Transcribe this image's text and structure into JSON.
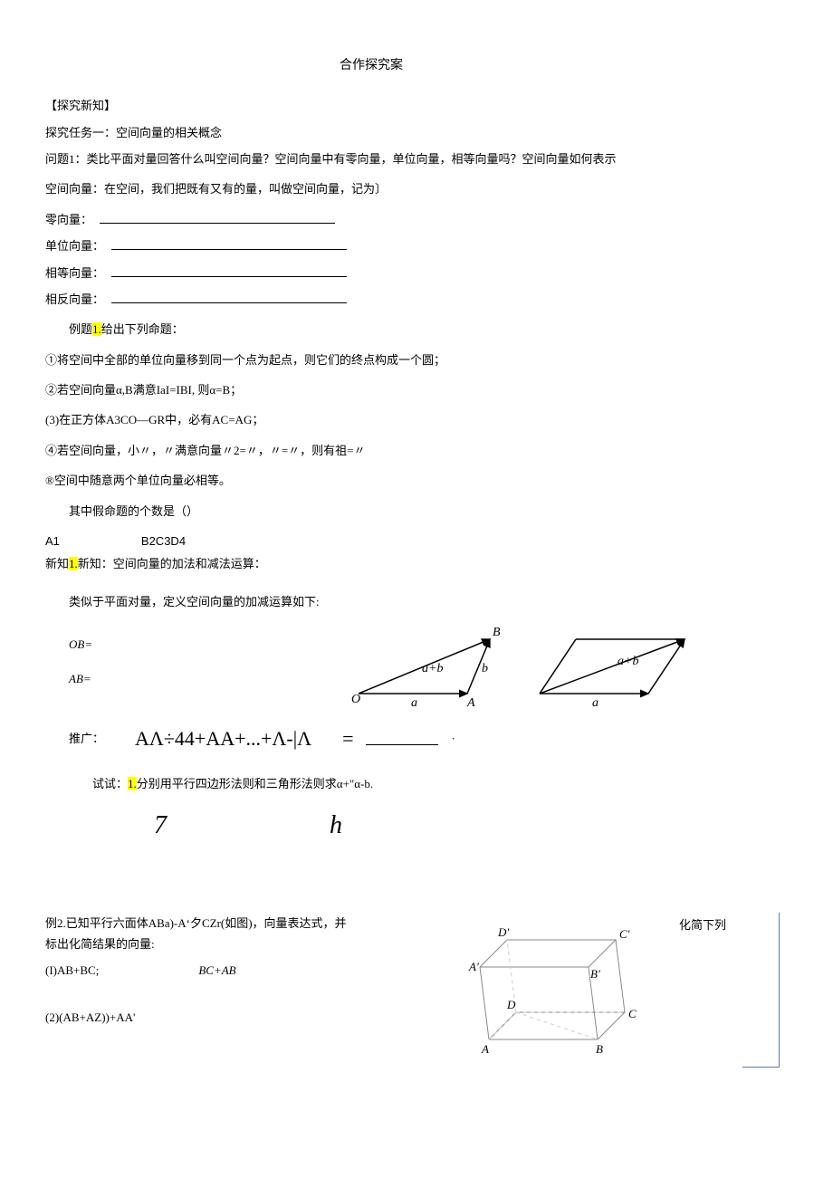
{
  "title": "合作探究案",
  "h1": "【探究新知】",
  "task1": "探究任务一：空间向量的相关概念",
  "q1": "问题1：类比平面对量回答什么叫空间向量？空间向量中有零向量，单位向量，相等向量吗？空间向量如何表示",
  "def_line": "空间向量：在空间，我们把既有又有的量，叫做空间向量，记为〕",
  "f_zero": "零向量：",
  "f_unit": "单位向量：",
  "f_equal": "相等向量：",
  "f_opp": "相反向量：",
  "ex1_head_pre": "例题",
  "ex1_head_hl": "1.",
  "ex1_head_post": "给出下列命题：",
  "p1": "①将空间中全部的单位向量移到同一个点为起点，则它们的终点构成一个圆；",
  "p2": "②若空间向量α,B满意IaI=IBI, 则α=B；",
  "p3": "(3)在正方体A3CO—GR中，必有AC=AG；",
  "p4": "④若空间向量，小〃，〃满意向量〃2=〃，〃=〃，则有祖=〃",
  "p5": "®空间中随意两个单位向量必相等。",
  "p_count": "其中假命题的个数是（）",
  "ans_a": "A1",
  "ans_bcd": "B2C3D4",
  "new_pre": "新知",
  "new_hl": "1.",
  "new_post": "新知：空间向量的加法和减法运算：",
  "analog": "类似于平面对量，定义空间向量的加减运算如下:",
  "ob": "OB=",
  "ab": "AB=",
  "ext_label": "推广：",
  "ext_formula": "AΛ÷44+AA+...+Λ-|Λ",
  "ext_eq": "=",
  "ext_dot": "·",
  "try_pre": "试试：",
  "try_hl": "1.",
  "try_post": "分别用平行四边形法则和三角形法则求α+\"α-b.",
  "sym7": "7",
  "symh": "h",
  "ex2_line1": "例2.已知平行六面体ABa)-A‘夕CZr(如图)，向量表达式，并",
  "ex2_tail_text": "化简下列",
  "ex2_line2": "标出化简结果的向量:",
  "ex2_i": "(I)AB+BC;",
  "ex2_i_r": "BC+AB",
  "ex2_ii": "(2)(AB+AZ))+AA'",
  "fig_tri": {
    "O": "O",
    "A": "A",
    "B": "B",
    "a": "a",
    "b": "b",
    "ab": "a+b"
  },
  "fig_para": {
    "a": "a",
    "ab": "a+b"
  },
  "fig_cube": {
    "A": "A",
    "B": "B",
    "C": "C",
    "D": "D",
    "Ap": "A'",
    "Bp": "B'",
    "Cp": "C'",
    "Dp": "D'"
  }
}
